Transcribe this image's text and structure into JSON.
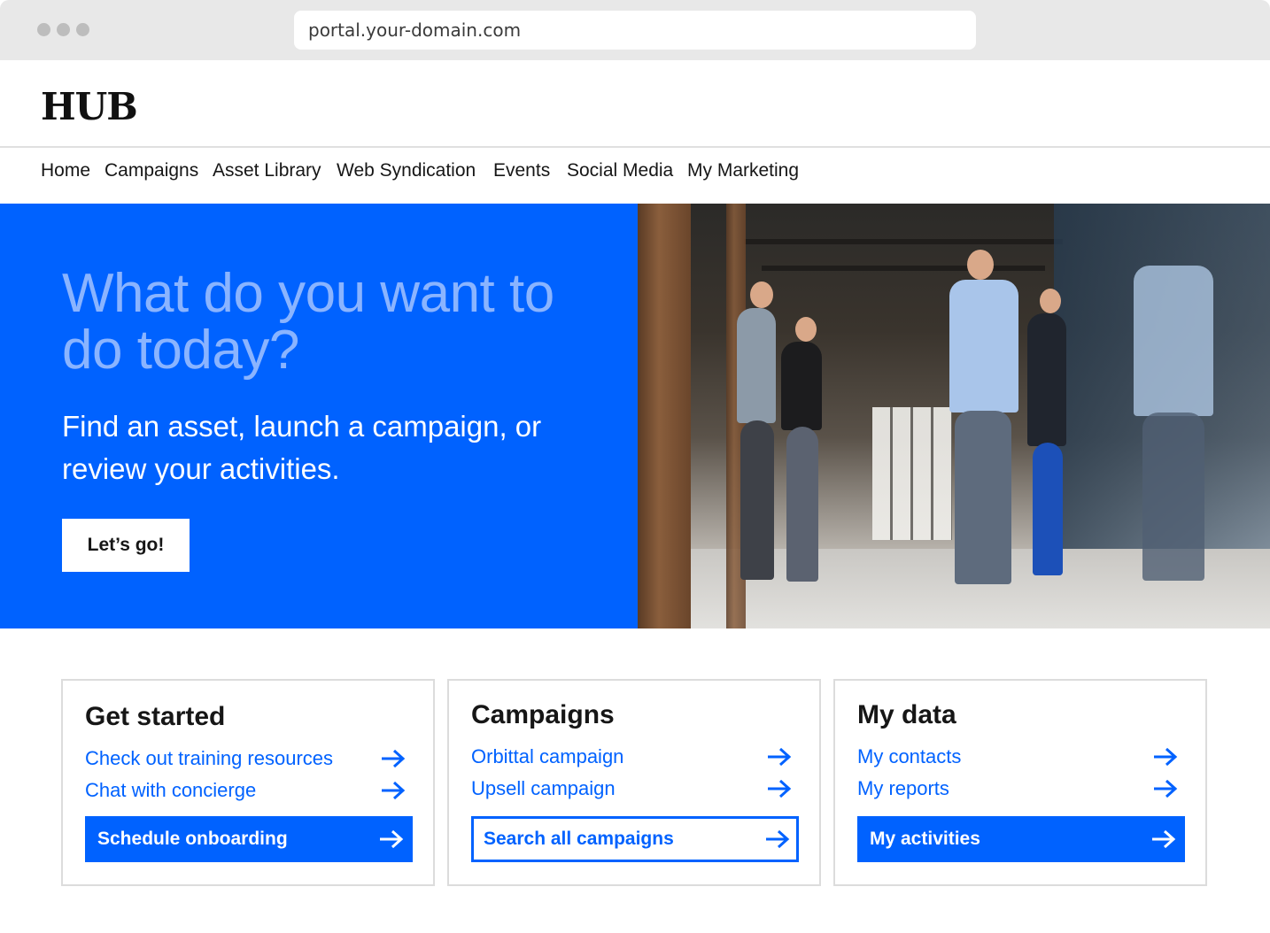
{
  "browser": {
    "url": "portal.your-domain.com"
  },
  "header": {
    "logo": "HUB"
  },
  "nav": {
    "items": [
      {
        "label": "Home"
      },
      {
        "label": "Campaigns"
      },
      {
        "label": "Asset Library"
      },
      {
        "label": "Web Syndication"
      },
      {
        "label": "Events"
      },
      {
        "label": "Social Media"
      },
      {
        "label": "My Marketing"
      }
    ]
  },
  "hero": {
    "heading": "What do you want to do today?",
    "subheading": "Find an asset, launch a campaign, or review your activities.",
    "button": "Let’s go!"
  },
  "cards": [
    {
      "title": "Get started",
      "links": [
        {
          "label": "Check out training resources"
        },
        {
          "label": "Chat with concierge"
        }
      ],
      "cta": "Schedule onboarding"
    },
    {
      "title": "Campaigns",
      "links": [
        {
          "label": "Orbittal campaign"
        },
        {
          "label": "Upsell campaign"
        }
      ],
      "cta": "Search all campaigns"
    },
    {
      "title": "My data",
      "links": [
        {
          "label": "My contacts"
        },
        {
          "label": "My reports"
        }
      ],
      "cta": "My activities"
    }
  ],
  "colors": {
    "accent": "#0062ff",
    "hero_heading": "#8ab4ff"
  }
}
